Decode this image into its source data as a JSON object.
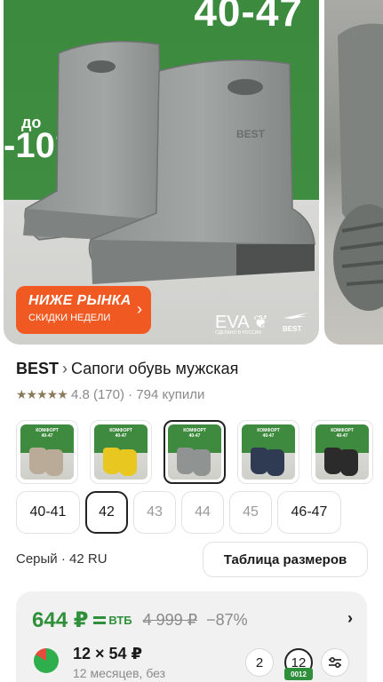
{
  "gallery": {
    "size_range": "40-47",
    "promo_up_to": "до",
    "promo_percent": "-10",
    "badge_title": "НИЖЕ РЫНКА",
    "badge_subtitle": "СКИДКИ НЕДЕЛИ",
    "material": "EVA",
    "made_in": "СДЕЛАНО В РОССИИ",
    "logo_text": "BEST",
    "boot_embossed": "BEST"
  },
  "product": {
    "brand": "BEST",
    "separator": "›",
    "name": "Сапоги обувь мужская",
    "stars": "★★★★★",
    "rating_text": "4.8 (170) · 794 купили"
  },
  "variants": [
    {
      "caption": "КОМФОРТ\n40-47",
      "boot_color": "#b9ab98"
    },
    {
      "caption": "КОМФОРТ\n40-47",
      "boot_color": "#e8c820"
    },
    {
      "caption": "КОМФОРТ\n40-47",
      "boot_color": "#8f9392",
      "selected": true
    },
    {
      "caption": "КОМФОРТ\n40-47",
      "boot_color": "#2f3b52"
    },
    {
      "caption": "КОМФОРТ\n40-47",
      "boot_color": "#2b2b2b"
    }
  ],
  "sizes": [
    {
      "label": "40-41",
      "state": "available"
    },
    {
      "label": "42",
      "state": "selected"
    },
    {
      "label": "43",
      "state": "disabled"
    },
    {
      "label": "44",
      "state": "disabled"
    },
    {
      "label": "45",
      "state": "disabled"
    },
    {
      "label": "46-47",
      "state": "available"
    }
  ],
  "selection": {
    "summary": "Серый · 42 RU",
    "size_table_button": "Таблица размеров"
  },
  "price": {
    "current": "644 ₽",
    "bank": "ВТБ",
    "old": "4 999 ₽",
    "discount": "−87%",
    "installment_main": "12 × 54 ₽",
    "installment_sub": "12 месяцев, без",
    "terms": [
      "2",
      "12"
    ],
    "term_tag": "0012"
  },
  "colors": {
    "accent_green": "#2f8f3a",
    "badge_orange": "#f05a22",
    "banner_green": "#3c8a3e"
  }
}
